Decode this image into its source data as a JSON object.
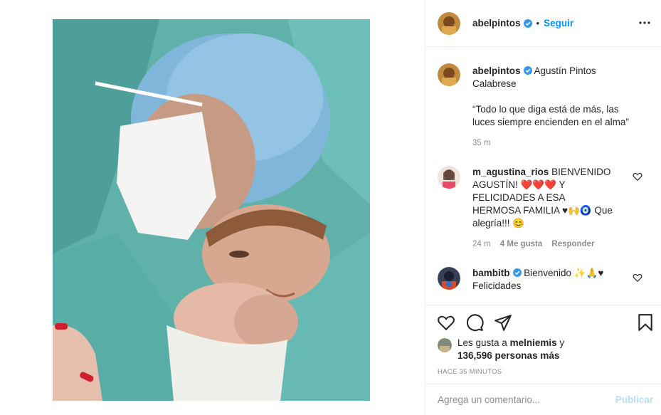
{
  "post": {
    "image_alt": "Foto de recién nacido en quirófano",
    "author": "abelpintos",
    "follow_label": "Seguir",
    "dot": "•"
  },
  "caption": {
    "username": "abelpintos",
    "title": "Agustín Pintos Calabrese",
    "quote": "“Todo lo que diga está de más, las luces siempre encienden en el alma”",
    "time": "35 m"
  },
  "comments": [
    {
      "username": "m_agustina_rios",
      "text": "BIENVENIDO AGUSTÍN! ❤️❤️❤️ Y FELICIDADES A ESA HERMOSA FAMILIA ♥🙌🧿 Que alegría!!! 😊",
      "time": "24 m",
      "likes": "4 Me gusta",
      "reply": "Responder"
    },
    {
      "username": "bambitb",
      "text": "Bienvenido ✨🙏♥ Felicidades"
    }
  ],
  "likes": {
    "prefix": "Les gusta a",
    "user": "melniemis",
    "conj": "y",
    "count": "136,596 personas más"
  },
  "ago": "HACE 35 MINUTOS",
  "add_comment": {
    "placeholder": "Agrega un comentario...",
    "publish": "Publicar"
  },
  "colors": {
    "accent": "#0095f6",
    "publish_disabled": "#b2dffc",
    "verified": "#3897f0",
    "muted": "#8e8e8e"
  }
}
